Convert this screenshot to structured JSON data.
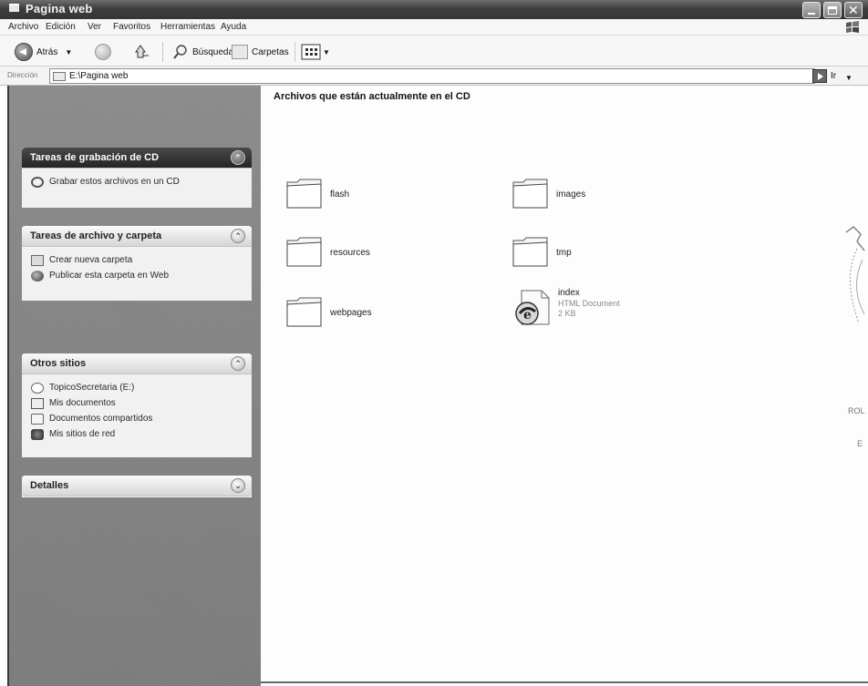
{
  "window": {
    "title": "Pagina web"
  },
  "menu": [
    "Archivo",
    "Edición",
    "Ver",
    "Favoritos",
    "Herramientas",
    "Ayuda"
  ],
  "toolbar": {
    "back_label": "Atrás",
    "search_label": "Búsqueda",
    "folders_label": "Carpetas"
  },
  "address": {
    "label": "Dirección",
    "value": "E:\\Pagina web",
    "go_label": "Ir"
  },
  "panels": [
    {
      "title": "Tareas de grabación de CD",
      "tasks": [
        "Grabar estos archivos en un CD"
      ]
    },
    {
      "title": "Tareas de archivo y carpeta",
      "tasks": [
        "Crear nueva carpeta",
        "Publicar esta carpeta en Web"
      ]
    },
    {
      "title": "Otros sitios",
      "tasks": [
        "TopicoSecretaria (E:)",
        "Mis documentos",
        "Documentos compartidos",
        "Mis sitios de red"
      ]
    },
    {
      "title": "Detalles",
      "tasks": []
    }
  ],
  "content": {
    "heading": "Archivos que están actualmente en el CD",
    "items": [
      {
        "name": "flash"
      },
      {
        "name": "images"
      },
      {
        "name": "resources"
      },
      {
        "name": "tmp"
      },
      {
        "name": "webpages"
      },
      {
        "name": "index",
        "type": "HTML Document",
        "size": "2 KB"
      }
    ]
  },
  "edge": {
    "text1": "ROL",
    "text2": "E"
  },
  "colors": {
    "titlebar": "#3e3e3e",
    "taskpane": "#828282",
    "panel_body": "#f1f1f1"
  }
}
